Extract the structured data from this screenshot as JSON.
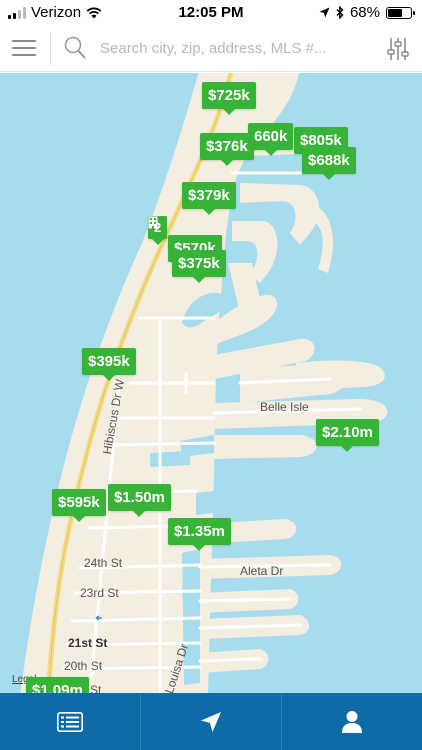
{
  "status_bar": {
    "carrier": "Verizon",
    "time": "12:05 PM",
    "battery": "68%",
    "battery_level": 0.68
  },
  "search": {
    "placeholder": "Search city, zip, address, MLS #..."
  },
  "map": {
    "streets": {
      "belle_isle": "Belle Isle",
      "hibiscus": "Hibiscus Dr W",
      "st_24": "24th St",
      "st_23": "23rd St",
      "st_21": "21st St",
      "st_20": "20th St",
      "aleta": "Aleta Dr",
      "louisa": "Louisa Dr",
      "st_partial": "St"
    },
    "legal": "Legal",
    "cluster": {
      "count": "2",
      "hidden_label": "$570k"
    },
    "pins": {
      "p725": "$725k",
      "p660": "660k",
      "p805": "$805k",
      "p376": "$376k",
      "p688": "$688k",
      "p379": "$379k",
      "p375": "$375k",
      "p395": "$395k",
      "p210": "$2.10m",
      "p595": "$595k",
      "p150": "$1.50m",
      "p135": "$1.35m",
      "p109": "$1.09m"
    },
    "colors": {
      "water": "#a7dcef",
      "land": "#f4eee0",
      "pin": "#37b337"
    }
  },
  "bottom_nav": {
    "items": [
      "list-view",
      "location",
      "profile"
    ],
    "color": "#0d6ca8"
  }
}
